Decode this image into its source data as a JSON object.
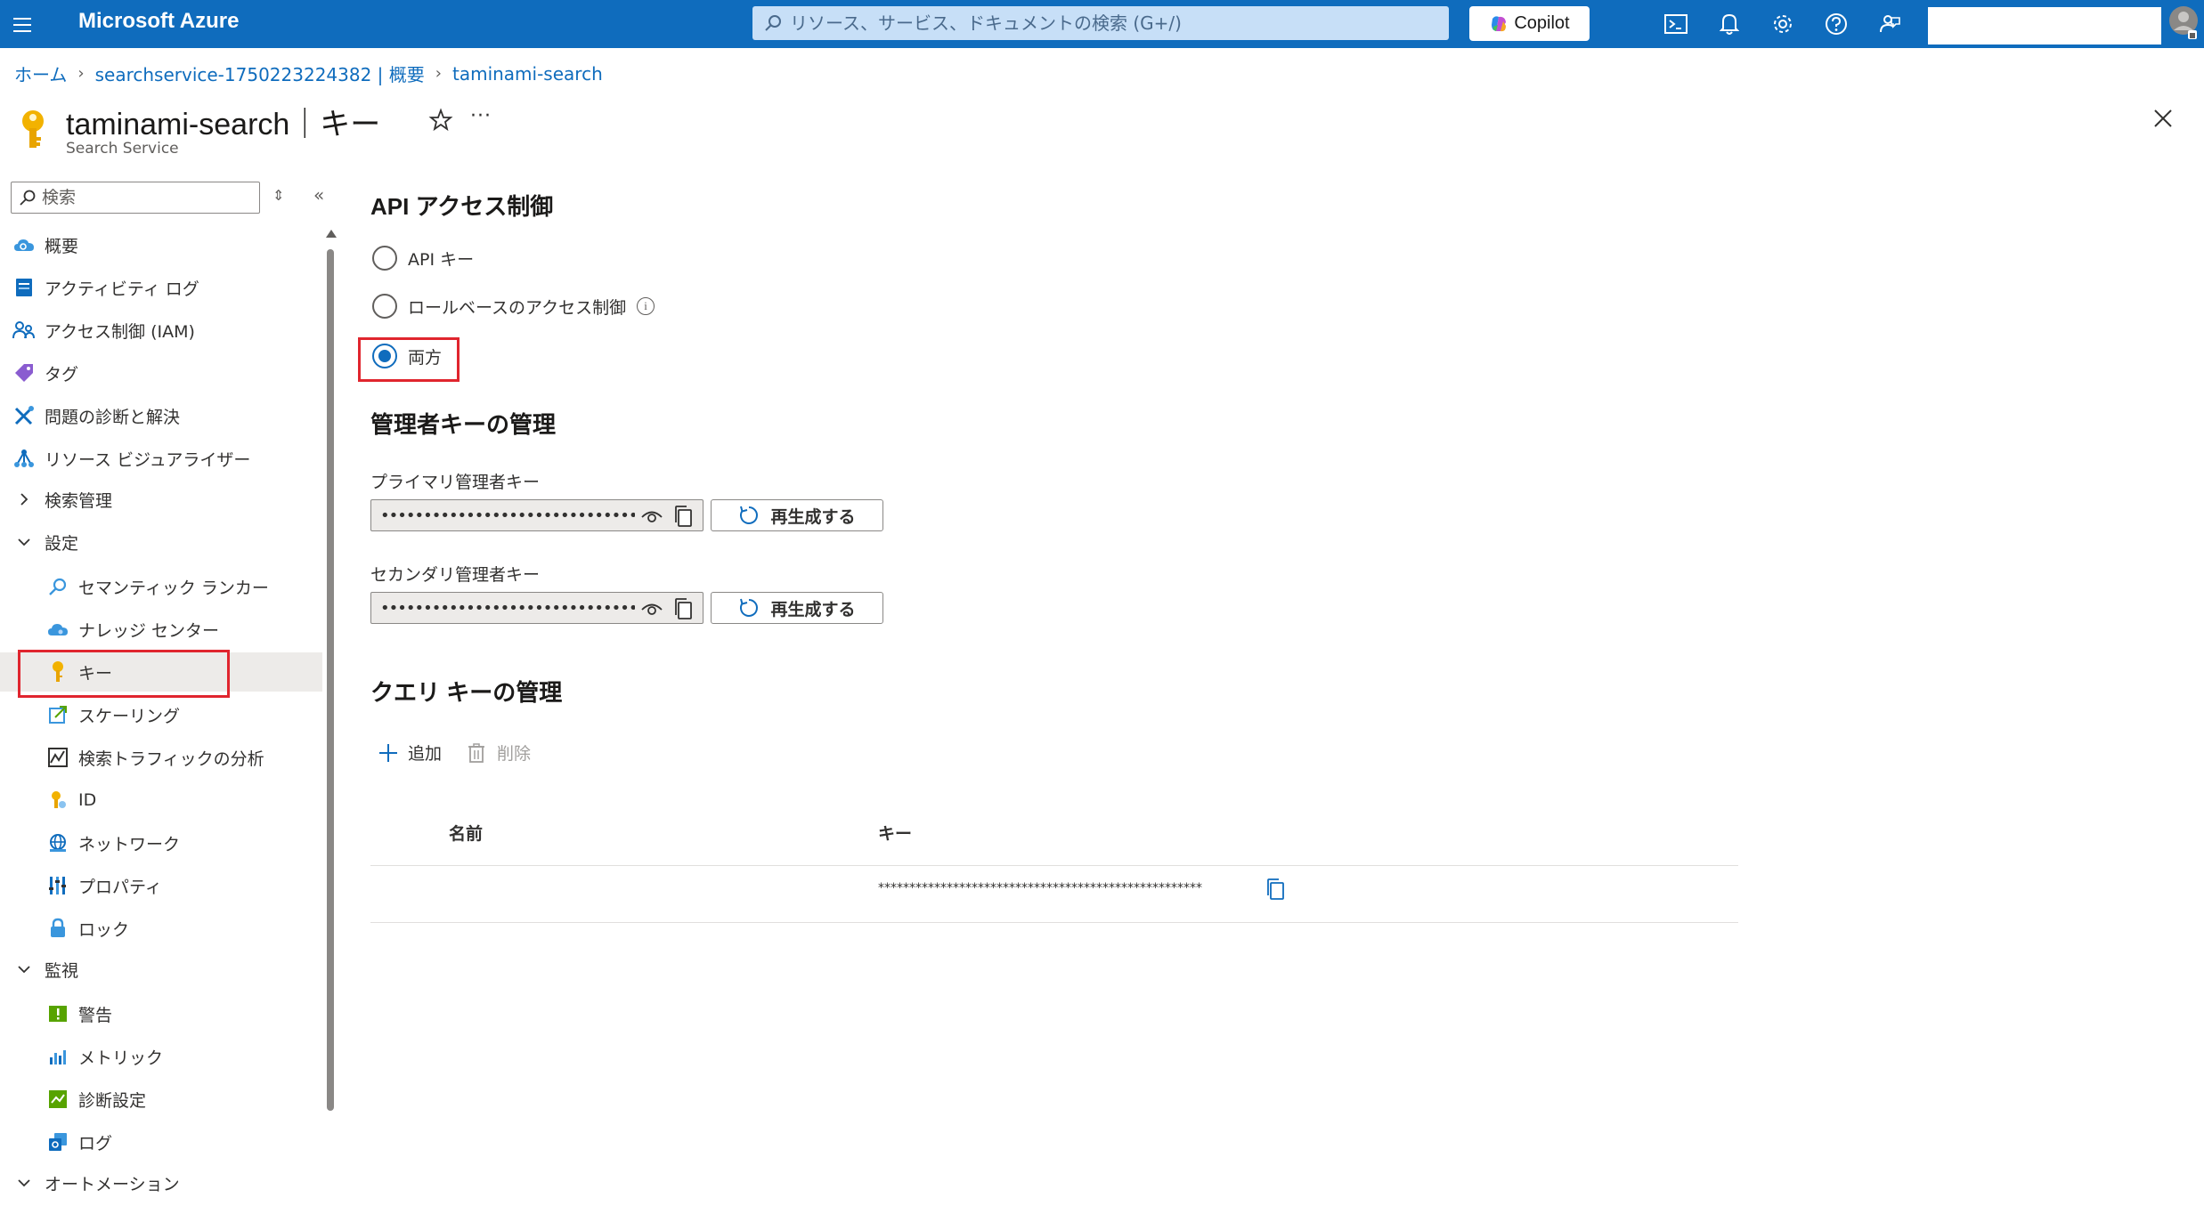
{
  "topbar": {
    "brand": "Microsoft Azure",
    "search_placeholder": "リソース、サービス、ドキュメントの検索 (G+/)",
    "copilot_label": "Copilot"
  },
  "breadcrumb": {
    "items": [
      "ホーム",
      "searchservice-1750223224382 | 概要",
      "taminami-search"
    ]
  },
  "header": {
    "title": "taminami-search｜キー",
    "subtitle": "Search Service"
  },
  "sidebar": {
    "search_placeholder": "検索",
    "items": [
      {
        "label": "概要",
        "icon": "cloud-search-icon"
      },
      {
        "label": "アクティビティ ログ",
        "icon": "activity-log-icon"
      },
      {
        "label": "アクセス制御 (IAM)",
        "icon": "people-icon"
      },
      {
        "label": "タグ",
        "icon": "tag-icon"
      },
      {
        "label": "問題の診断と解決",
        "icon": "wrench-icon"
      },
      {
        "label": "リソース ビジュアライザー",
        "icon": "visualizer-icon"
      },
      {
        "label": "検索管理",
        "icon": "chevron-right-icon"
      },
      {
        "label": "設定",
        "icon": "chevron-down-icon"
      },
      {
        "label": "セマンティック ランカー",
        "icon": "search-icon"
      },
      {
        "label": "ナレッジ センター",
        "icon": "knowledge-cloud-icon"
      },
      {
        "label": "キー",
        "icon": "key-icon"
      },
      {
        "label": "スケーリング",
        "icon": "scaling-icon"
      },
      {
        "label": "検索トラフィックの分析",
        "icon": "traffic-chart-icon"
      },
      {
        "label": "ID",
        "icon": "identity-icon"
      },
      {
        "label": "ネットワーク",
        "icon": "network-icon"
      },
      {
        "label": "プロパティ",
        "icon": "properties-icon"
      },
      {
        "label": "ロック",
        "icon": "lock-icon"
      },
      {
        "label": "監視",
        "icon": "chevron-down-icon"
      },
      {
        "label": "警告",
        "icon": "alert-icon"
      },
      {
        "label": "メトリック",
        "icon": "metrics-icon"
      },
      {
        "label": "診断設定",
        "icon": "diagnostic-settings-icon"
      },
      {
        "label": "ログ",
        "icon": "logs-icon"
      },
      {
        "label": "オートメーション",
        "icon": "chevron-down-icon"
      }
    ]
  },
  "main": {
    "api_access_heading": "API アクセス制御",
    "radio_options": [
      {
        "label": "API キー",
        "checked": false
      },
      {
        "label": "ロールベースのアクセス制御",
        "checked": false
      },
      {
        "label": "両方",
        "checked": true
      }
    ],
    "admin_heading": "管理者キーの管理",
    "primary_label": "プライマリ管理者キー",
    "secondary_label": "セカンダリ管理者キー",
    "masked_key": "••••••••••••••••••••••••••••••••••...",
    "regenerate_label": "再生成する",
    "query_heading": "クエリ キーの管理",
    "add_label": "追加",
    "delete_label": "削除",
    "table": {
      "columns": [
        "名前",
        "キー"
      ],
      "rows": [
        {
          "name": "",
          "key": "****************************************************"
        }
      ]
    }
  },
  "colors": {
    "azure_blue": "#0f6cbd",
    "highlight_red": "#e0252e",
    "key_gold": "#f2b200"
  }
}
